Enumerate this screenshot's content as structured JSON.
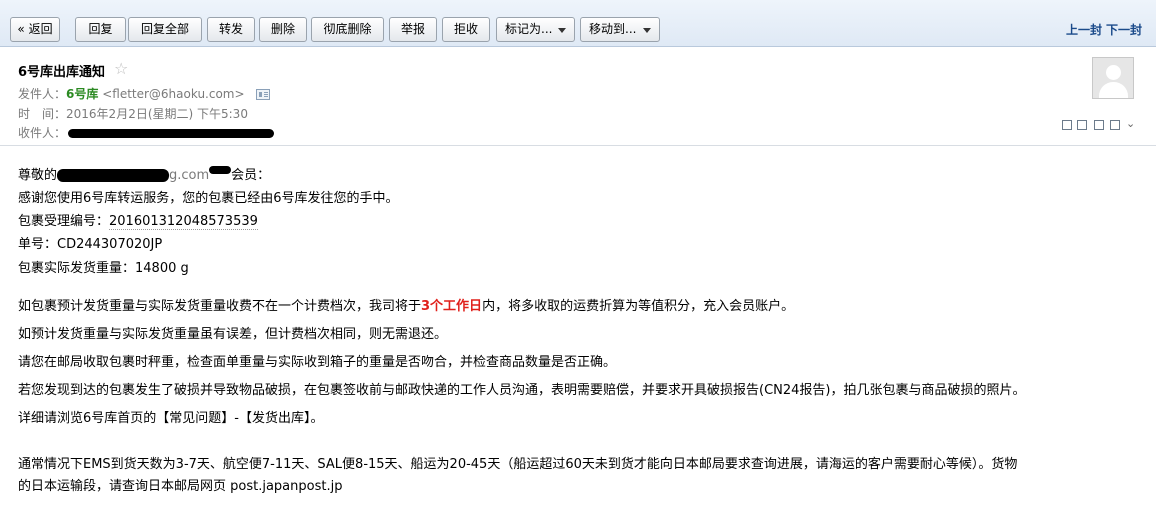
{
  "toolbar": {
    "back": "« 返回",
    "reply": "回复",
    "reply_all": "回复全部",
    "forward": "转发",
    "delete": "删除",
    "delete_permanently": "彻底删除",
    "report": "举报",
    "reject": "拒收",
    "mark_as": "标记为...",
    "move_to": "移动到...",
    "prev": "上一封",
    "next": "下一封"
  },
  "header": {
    "subject": "6号库出库通知",
    "sender_label": "发件人：",
    "sender_name": "6号库",
    "sender_addr": "<fletter@6haoku.com>",
    "time_label": "时　间：",
    "time_value": "2016年2月2日(星期二) 下午5:30",
    "recipient_label": "收件人："
  },
  "icons": {
    "star": "star-icon",
    "contact_card": "contact-card-icon",
    "avatar": "avatar-placeholder",
    "new_window": "new-window-icon",
    "show_source": "show-source-icon",
    "download": "download-icon",
    "print": "print-icon",
    "more": "chevron-down-icon"
  },
  "body": {
    "greeting_prefix": "尊敬的",
    "greeting_partial": "g.com",
    "greeting_suffix": "会员：",
    "line1": "感谢您使用6号库转运服务，您的包裹已经由6号库发往您的手中。",
    "pkg_no_label": "包裹受理编号：",
    "pkg_no_value": "201601312048573539",
    "tracking_label": "单号：",
    "tracking_value": "CD244307020JP",
    "weight_label": "包裹实际发货重量：",
    "weight_value": "14800 g",
    "para1_a": "如包裹预计发货重量与实际发货重量收费不在一个计费档次，我司将于",
    "para1_em": "3个工作日",
    "para1_b": "内，将多收取的运费折算为等值积分，充入会员账户。",
    "para2": "如预计发货重量与实际发货重量虽有误差，但计费档次相同，则无需退还。",
    "para3": "请您在邮局收取包裹时秤重，检查面单重量与实际收到箱子的重量是否吻合，并检查商品数量是否正确。",
    "para4": "若您发现到达的包裹发生了破损并导致物品破损，在包裹签收前与邮政快递的工作人员沟通，表明需要赔偿，并要求开具破损报告(CN24报告)，拍几张包裹与商品破损的照片。",
    "para5": "详细请浏览6号库首页的【常见问题】-【发货出库】。",
    "para6_line1": "通常情况下EMS到货天数为3-7天、航空便7-11天、SAL便8-15天、船运为20-45天（船运超过60天未到货才能向日本邮局要求查询进展，请海运的客户需要耐心等候）。货物",
    "para6_line2": "的日本运输段，请查询日本邮局网页 post.japanpost.jp"
  },
  "colors": {
    "sender_green": "#2b8a22",
    "emphasis_red": "#e0201b",
    "nav_blue": "#1a4a8a",
    "toolbar_bg": "#dfe9f5"
  }
}
